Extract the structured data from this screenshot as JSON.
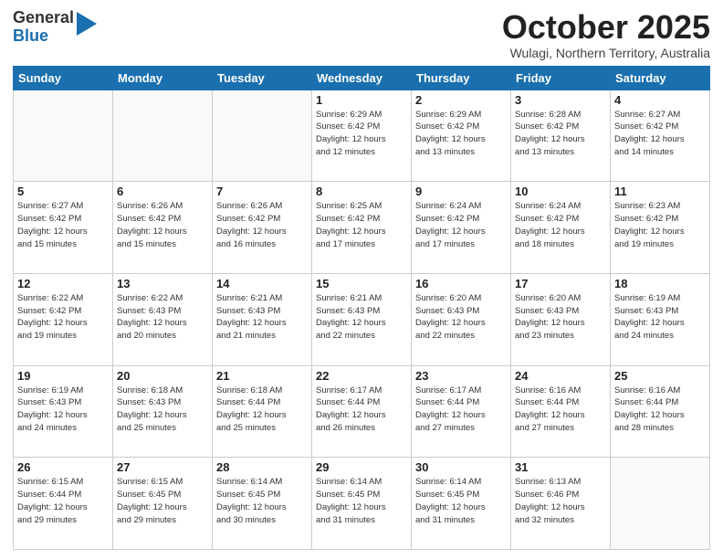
{
  "header": {
    "logo_general": "General",
    "logo_blue": "Blue",
    "month_title": "October 2025",
    "location": "Wulagi, Northern Territory, Australia"
  },
  "weekdays": [
    "Sunday",
    "Monday",
    "Tuesday",
    "Wednesday",
    "Thursday",
    "Friday",
    "Saturday"
  ],
  "days": {
    "1": {
      "sunrise": "6:29 AM",
      "sunset": "6:42 PM",
      "daylight": "12 hours and 12 minutes"
    },
    "2": {
      "sunrise": "6:29 AM",
      "sunset": "6:42 PM",
      "daylight": "12 hours and 13 minutes"
    },
    "3": {
      "sunrise": "6:28 AM",
      "sunset": "6:42 PM",
      "daylight": "12 hours and 13 minutes"
    },
    "4": {
      "sunrise": "6:27 AM",
      "sunset": "6:42 PM",
      "daylight": "12 hours and 14 minutes"
    },
    "5": {
      "sunrise": "6:27 AM",
      "sunset": "6:42 PM",
      "daylight": "12 hours and 15 minutes"
    },
    "6": {
      "sunrise": "6:26 AM",
      "sunset": "6:42 PM",
      "daylight": "12 hours and 15 minutes"
    },
    "7": {
      "sunrise": "6:26 AM",
      "sunset": "6:42 PM",
      "daylight": "12 hours and 16 minutes"
    },
    "8": {
      "sunrise": "6:25 AM",
      "sunset": "6:42 PM",
      "daylight": "12 hours and 17 minutes"
    },
    "9": {
      "sunrise": "6:24 AM",
      "sunset": "6:42 PM",
      "daylight": "12 hours and 17 minutes"
    },
    "10": {
      "sunrise": "6:24 AM",
      "sunset": "6:42 PM",
      "daylight": "12 hours and 18 minutes"
    },
    "11": {
      "sunrise": "6:23 AM",
      "sunset": "6:42 PM",
      "daylight": "12 hours and 19 minutes"
    },
    "12": {
      "sunrise": "6:22 AM",
      "sunset": "6:42 PM",
      "daylight": "12 hours and 19 minutes"
    },
    "13": {
      "sunrise": "6:22 AM",
      "sunset": "6:43 PM",
      "daylight": "12 hours and 20 minutes"
    },
    "14": {
      "sunrise": "6:21 AM",
      "sunset": "6:43 PM",
      "daylight": "12 hours and 21 minutes"
    },
    "15": {
      "sunrise": "6:21 AM",
      "sunset": "6:43 PM",
      "daylight": "12 hours and 22 minutes"
    },
    "16": {
      "sunrise": "6:20 AM",
      "sunset": "6:43 PM",
      "daylight": "12 hours and 22 minutes"
    },
    "17": {
      "sunrise": "6:20 AM",
      "sunset": "6:43 PM",
      "daylight": "12 hours and 23 minutes"
    },
    "18": {
      "sunrise": "6:19 AM",
      "sunset": "6:43 PM",
      "daylight": "12 hours and 24 minutes"
    },
    "19": {
      "sunrise": "6:19 AM",
      "sunset": "6:43 PM",
      "daylight": "12 hours and 24 minutes"
    },
    "20": {
      "sunrise": "6:18 AM",
      "sunset": "6:43 PM",
      "daylight": "12 hours and 25 minutes"
    },
    "21": {
      "sunrise": "6:18 AM",
      "sunset": "6:44 PM",
      "daylight": "12 hours and 25 minutes"
    },
    "22": {
      "sunrise": "6:17 AM",
      "sunset": "6:44 PM",
      "daylight": "12 hours and 26 minutes"
    },
    "23": {
      "sunrise": "6:17 AM",
      "sunset": "6:44 PM",
      "daylight": "12 hours and 27 minutes"
    },
    "24": {
      "sunrise": "6:16 AM",
      "sunset": "6:44 PM",
      "daylight": "12 hours and 27 minutes"
    },
    "25": {
      "sunrise": "6:16 AM",
      "sunset": "6:44 PM",
      "daylight": "12 hours and 28 minutes"
    },
    "26": {
      "sunrise": "6:15 AM",
      "sunset": "6:44 PM",
      "daylight": "12 hours and 29 minutes"
    },
    "27": {
      "sunrise": "6:15 AM",
      "sunset": "6:45 PM",
      "daylight": "12 hours and 29 minutes"
    },
    "28": {
      "sunrise": "6:14 AM",
      "sunset": "6:45 PM",
      "daylight": "12 hours and 30 minutes"
    },
    "29": {
      "sunrise": "6:14 AM",
      "sunset": "6:45 PM",
      "daylight": "12 hours and 31 minutes"
    },
    "30": {
      "sunrise": "6:14 AM",
      "sunset": "6:45 PM",
      "daylight": "12 hours and 31 minutes"
    },
    "31": {
      "sunrise": "6:13 AM",
      "sunset": "6:46 PM",
      "daylight": "12 hours and 32 minutes"
    }
  },
  "labels": {
    "sunrise": "Sunrise:",
    "sunset": "Sunset:",
    "daylight": "Daylight:"
  }
}
